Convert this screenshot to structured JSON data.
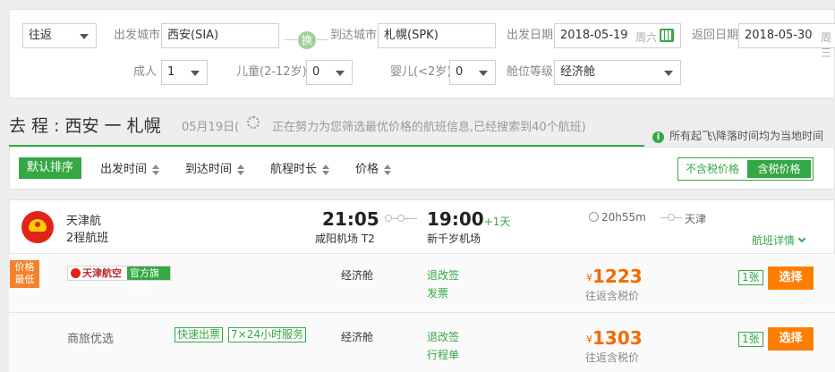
{
  "search": {
    "trip_type": "往返",
    "depart_city_label": "出发城市",
    "depart_city": "西安(SIA)",
    "swap_label": "换",
    "arrive_city_label": "到达城市",
    "arrive_city": "札幌(SPK)",
    "depart_date_label": "出发日期",
    "depart_date": "2018-05-19",
    "depart_weekday": "周六",
    "return_date_label": "返回日期",
    "return_date": "2018-05-30",
    "return_weekday": "周三",
    "adult_label": "成人",
    "adult_count": "1",
    "child_label": "儿童(2-12岁)",
    "child_count": "0",
    "infant_label": "婴儿(<2岁)",
    "infant_count": "0",
    "cabin_label": "舱位等级",
    "cabin": "经济舱"
  },
  "heading": {
    "title": "去 程 : 西安 一 札幌",
    "date_prefix": "05月19日(",
    "status": "正在努力为您筛选最优价格的航班信息,已经搜索到40个航班)",
    "note": "所有起飞\\降落时间均为当地时间",
    "note_icon": "info-icon"
  },
  "sort": {
    "default": "默认排序",
    "depart_time": "出发时间",
    "arrive_time": "到达时间",
    "duration": "航程时长",
    "price": "价格",
    "tax_excluded": "不含税价格",
    "tax_included": "含税价格"
  },
  "flight": {
    "airline": "天津航",
    "legs": "2程航班",
    "depart_time": "21:05",
    "depart_airport": "咸阳机场 T2",
    "arrive_time": "19:00",
    "arrive_plus": "+1天",
    "arrive_airport": "新千岁机场",
    "duration": "20h55m",
    "stop_city": "天津",
    "details": "航班详情",
    "offers": [
      {
        "badge": "价格最低",
        "badge_line1": "价格",
        "badge_line2": "最低",
        "vendor_name": "天津航空",
        "vendor_tag": "官方旗舰店",
        "cabin": "经济舱",
        "refund": "退改签",
        "invoice": "发票",
        "currency": "¥",
        "price": "1223",
        "price_note": "往返含税价",
        "count": "1张",
        "choose": "选择"
      },
      {
        "vendor_name": "商旅优选",
        "tag1": "快速出票",
        "tag2": "7×24小时服务",
        "cabin": "经济舱",
        "refund": "退改签",
        "invoice": "行程单",
        "currency": "¥",
        "price": "1303",
        "price_note": "往返含税价",
        "count": "1张",
        "choose": "选择"
      }
    ]
  },
  "colors": {
    "accent_green": "#35a845",
    "price_orange": "#f56a00",
    "button_orange": "#ff7e00",
    "badge_orange": "#f5822a"
  }
}
